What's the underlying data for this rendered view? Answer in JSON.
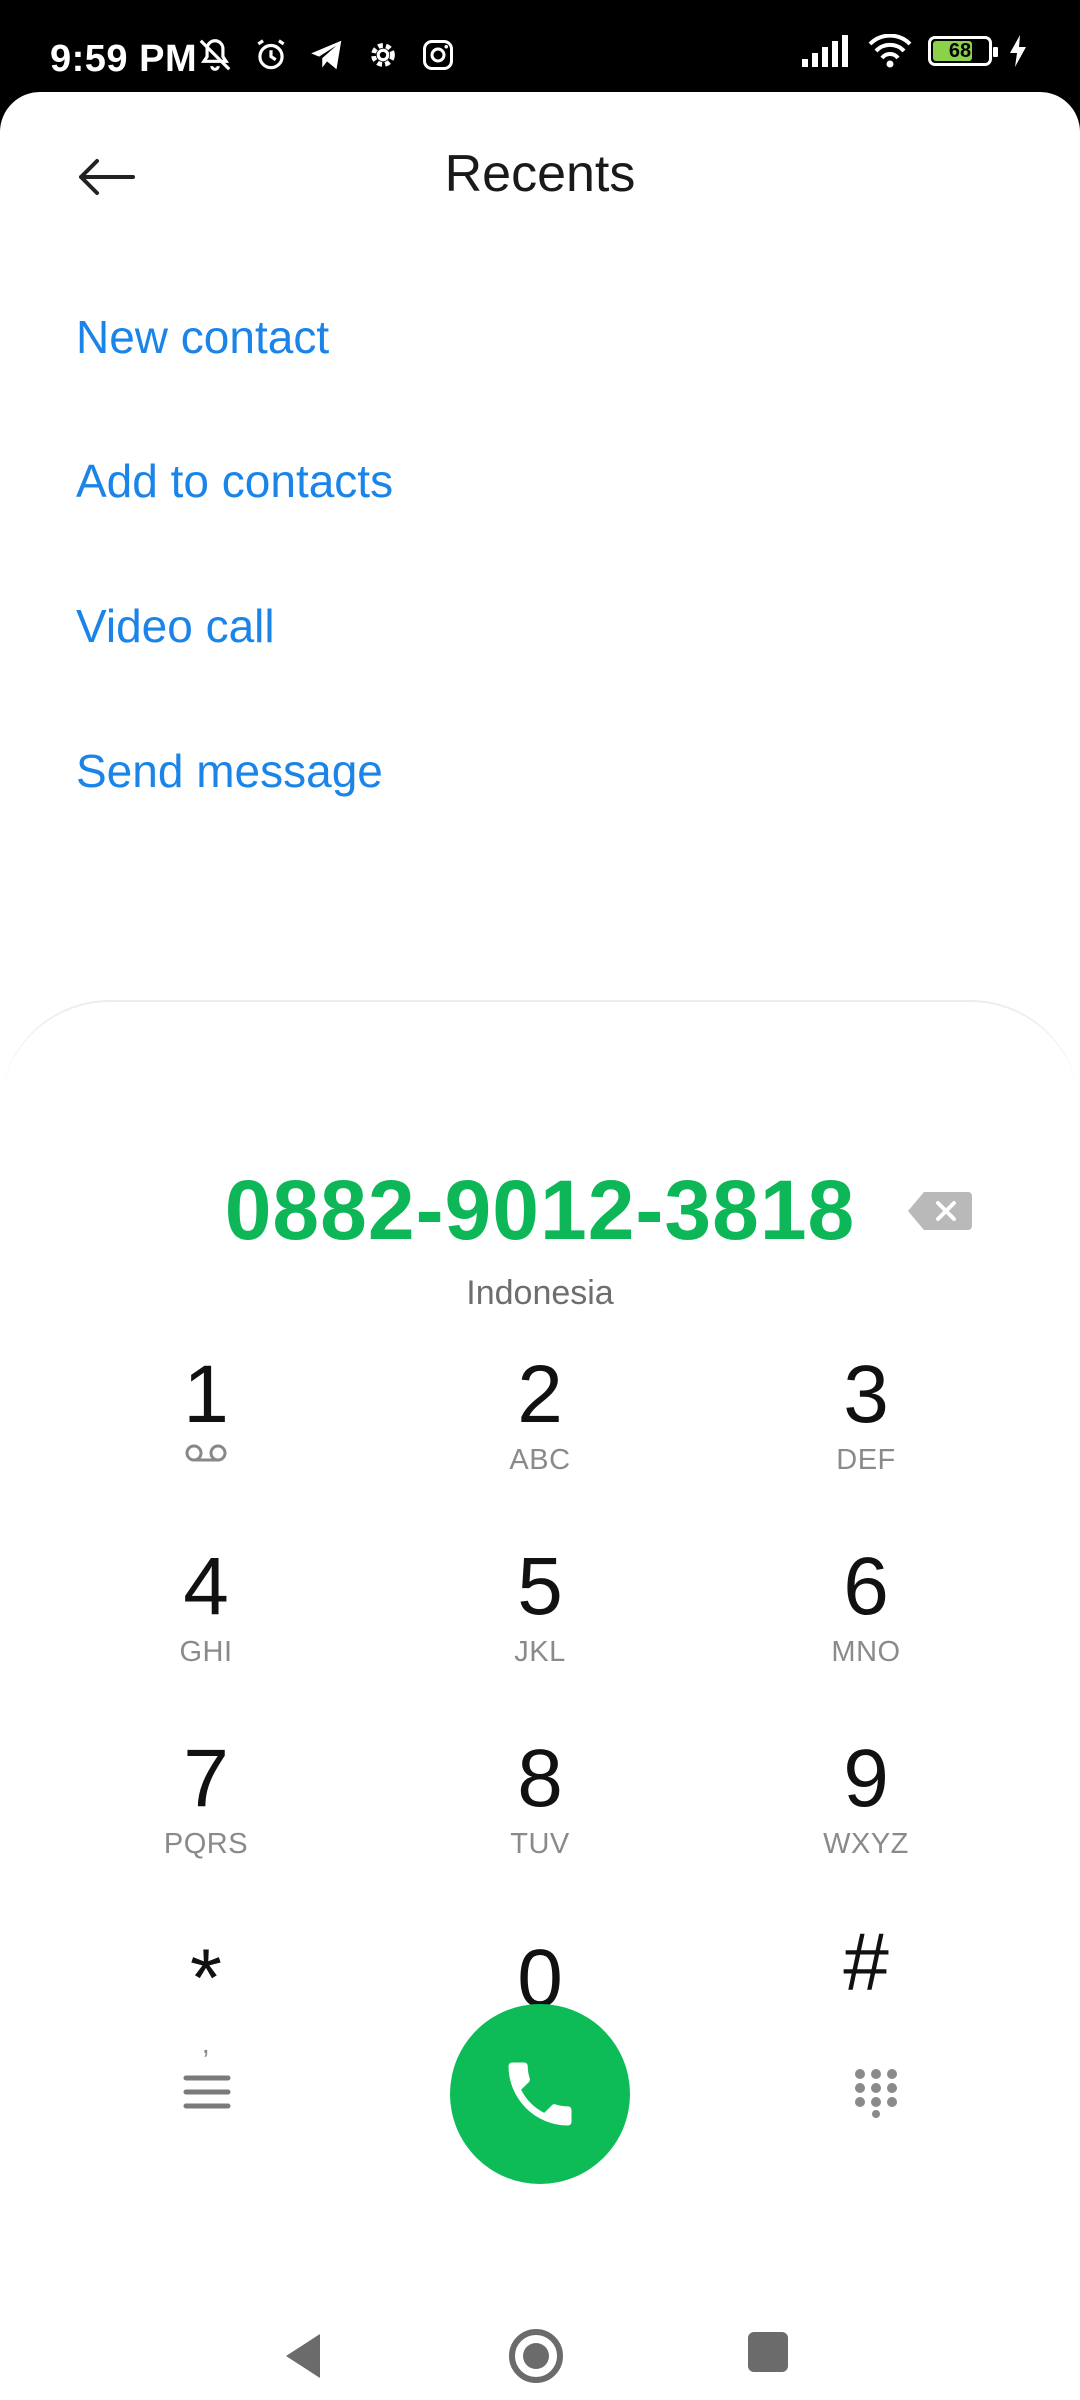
{
  "status_bar": {
    "time": "9:59 PM",
    "battery_level": "68",
    "left_icons": [
      "mute-icon",
      "alarm-icon",
      "telegram-icon",
      "settings-icon",
      "instagram-icon"
    ],
    "right_icons": [
      "signal-icon",
      "wifi-icon",
      "battery-icon",
      "charging-icon"
    ]
  },
  "header": {
    "title": "Recents",
    "back_icon": "back-arrow-icon"
  },
  "actions": [
    {
      "label": "New contact"
    },
    {
      "label": "Add to contacts"
    },
    {
      "label": "Video call"
    },
    {
      "label": "Send message"
    }
  ],
  "dialer": {
    "number": "0882-9012-3818",
    "country": "Indonesia",
    "keys": [
      {
        "digit": "1",
        "letters": ""
      },
      {
        "digit": "2",
        "letters": "ABC"
      },
      {
        "digit": "3",
        "letters": "DEF"
      },
      {
        "digit": "4",
        "letters": "GHI"
      },
      {
        "digit": "5",
        "letters": "JKL"
      },
      {
        "digit": "6",
        "letters": "MNO"
      },
      {
        "digit": "7",
        "letters": "PQRS"
      },
      {
        "digit": "8",
        "letters": "TUV"
      },
      {
        "digit": "9",
        "letters": "WXYZ"
      },
      {
        "digit": "*",
        "letters": ","
      },
      {
        "digit": "0",
        "letters": "+"
      },
      {
        "digit": "#",
        "letters": ""
      }
    ]
  },
  "colors": {
    "accent_blue": "#1a84e8",
    "number_green": "#0db657",
    "call_button": "#0dbb57"
  }
}
